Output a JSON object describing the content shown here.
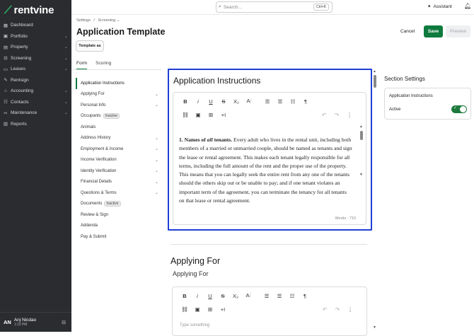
{
  "app": {
    "logo": "rentvine"
  },
  "sidebar": {
    "items": [
      {
        "label": "Dashboard",
        "icon": "dashboard-icon",
        "glyph": "▦",
        "chev": ""
      },
      {
        "label": "Portfolio",
        "icon": "briefcase-icon",
        "glyph": "▣",
        "chev": "⌄"
      },
      {
        "label": "Property",
        "icon": "building-icon",
        "glyph": "▤",
        "chev": "⌄"
      },
      {
        "label": "Screening",
        "icon": "funnel-icon",
        "glyph": "⊟",
        "chev": "⌄"
      },
      {
        "label": "Leases",
        "icon": "document-icon",
        "glyph": "▭",
        "chev": "⌄"
      },
      {
        "label": "Rentsign",
        "icon": "signature-icon",
        "glyph": "✎",
        "chev": ""
      },
      {
        "label": "Accounting",
        "icon": "bank-icon",
        "glyph": "⌂",
        "chev": "⌄"
      },
      {
        "label": "Contacts",
        "icon": "contact-card-icon",
        "glyph": "☷",
        "chev": "⌄"
      },
      {
        "label": "Maintenance",
        "icon": "wrench-icon",
        "glyph": "✂",
        "chev": "⌄"
      },
      {
        "label": "Reports",
        "icon": "chart-icon",
        "glyph": "▥",
        "chev": ""
      }
    ],
    "user": {
      "initials": "AN",
      "name": "Anj Nicdao",
      "time": "1:23 PM"
    }
  },
  "topbar": {
    "search_placeholder": "Search...",
    "shortcut": "Ctrl+K",
    "assistant": "Assistant"
  },
  "header": {
    "breadcrumb1": "Settings",
    "breadcrumb_sep": "/",
    "breadcrumb2": "Screening",
    "title": "Application Template",
    "cancel": "Cancel",
    "save": "Save",
    "preview": "Preview",
    "template_btn": "Template as"
  },
  "tabs": {
    "form": "Form",
    "scoring": "Scoring"
  },
  "sections": [
    {
      "label": "Application Instructions",
      "chev": "",
      "badge": "",
      "active": true
    },
    {
      "label": "Applying For",
      "chev": "⌄",
      "badge": ""
    },
    {
      "label": "Personal Info",
      "chev": "⌄",
      "badge": ""
    },
    {
      "label": "Occupants",
      "chev": "",
      "badge": "Inactive"
    },
    {
      "label": "Animals",
      "chev": "",
      "badge": ""
    },
    {
      "label": "Address History",
      "chev": "⌄",
      "badge": ""
    },
    {
      "label": "Employment & Income",
      "chev": "⌄",
      "badge": ""
    },
    {
      "label": "Income Verification",
      "chev": "⌄",
      "badge": ""
    },
    {
      "label": "Identity Verification",
      "chev": "⌄",
      "badge": ""
    },
    {
      "label": "Financial Details",
      "chev": "⌄",
      "badge": ""
    },
    {
      "label": "Questions & Terms",
      "chev": "⌄",
      "badge": ""
    },
    {
      "label": "Documents",
      "chev": "",
      "badge": "Inactive"
    },
    {
      "label": "Review & Sign",
      "chev": "",
      "badge": ""
    },
    {
      "label": "Addenda",
      "chev": "",
      "badge": ""
    },
    {
      "label": "Pay & Submit",
      "chev": "",
      "badge": ""
    }
  ],
  "editor": {
    "heading": "Application Instructions",
    "content_lead": "1. Names of ",
    "content_em": "all",
    "content_lead2": " tenants.",
    "content_body": " Every adult who lives in the rental unit, including both members of a married or unmarried couple, should be named as tenants and sign the lease or rental agreement. This makes each tenant legally responsible for all terms, including the full amount of the rent and the proper use of the property. This means that you can legally seek the entire rent from any one of the tenants should the others skip out or be unable to pay; and if one tenant violates an important term of the agreement, you can terminate the tenancy for all tenants on that lease or rental agreement.",
    "words": "Words : 710"
  },
  "toolbar": {
    "bold": "B",
    "italic": "i",
    "underline": "U",
    "strike": "S",
    "subscript": "X₂",
    "font_size": "A⫶",
    "align_left": "☰",
    "align_center": "☰",
    "list": "☷",
    "paragraph": "¶",
    "link": "⛓",
    "image": "▣",
    "table": "⊞",
    "insert": "+I",
    "undo": "↶",
    "redo": "↷",
    "more": "⋮"
  },
  "section2": {
    "heading": "Applying For",
    "subheading": "Applying For",
    "placeholder": "Type something"
  },
  "settings": {
    "title": "Section Settings",
    "section_label": "Application Instructions",
    "active_label": "Active",
    "active": true
  }
}
